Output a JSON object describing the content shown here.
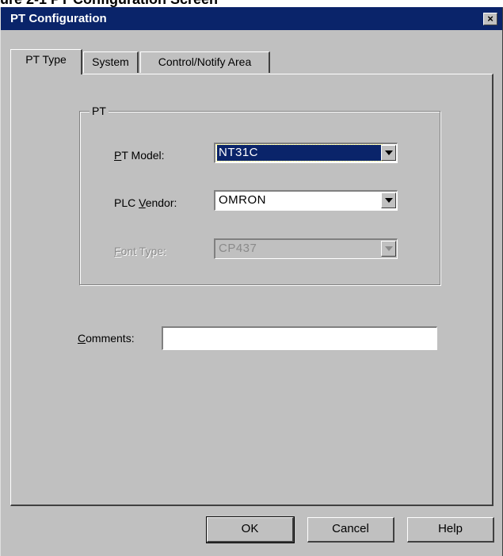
{
  "caption": "ure 2-1 PT Configuration Screen",
  "window": {
    "title": "PT Configuration",
    "close_symbol": "×"
  },
  "tabs": [
    {
      "label": "PT Type",
      "active": true
    },
    {
      "label": "System",
      "active": false
    },
    {
      "label": "Control/Notify Area",
      "active": false
    }
  ],
  "group": {
    "legend": "PT",
    "pt_model": {
      "label_pre": "",
      "label_mnemonic": "P",
      "label_post": "T Model:",
      "value": "NT31C",
      "selected": true
    },
    "plc_vendor": {
      "label_pre": "PLC ",
      "label_mnemonic": "V",
      "label_post": "endor:",
      "value": "OMRON"
    },
    "font_type": {
      "label_pre": "",
      "label_mnemonic": "F",
      "label_post": "ont Type:",
      "value": "CP437",
      "disabled": true
    }
  },
  "comments": {
    "label_pre": "",
    "label_mnemonic": "C",
    "label_post": "omments:",
    "value": ""
  },
  "buttons": {
    "ok": "OK",
    "cancel": "Cancel",
    "help": "Help"
  },
  "colors": {
    "titlebar": "#0a246a",
    "dialog_face": "#c0c0c0",
    "selection": "#0a246a"
  },
  "icons": {
    "close": "close-icon",
    "dropdown": "chevron-down-icon"
  }
}
